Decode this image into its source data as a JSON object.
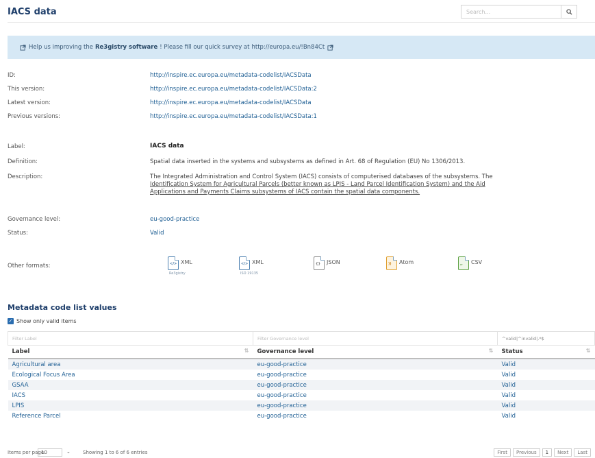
{
  "header": {
    "title": "IACS data",
    "search_placeholder": "Search...",
    "search_icon": "magnifier-icon"
  },
  "banner": {
    "text_before": "Help us improving the",
    "software": "Re3gistry software",
    "text_after": "! Please fill our quick survey at",
    "link": "http://europa.eu/!Bn84Ct"
  },
  "versions": {
    "id_label": "ID:",
    "id_value": "http://inspire.ec.europa.eu/metadata-codelist/IACSData",
    "this_label": "This version:",
    "this_value": "http://inspire.ec.europa.eu/metadata-codelist/IACSData:2",
    "latest_label": "Latest version:",
    "latest_value": "http://inspire.ec.europa.eu/metadata-codelist/IACSData",
    "previous_label": "Previous versions:",
    "previous_value": "http://inspire.ec.europa.eu/metadata-codelist/IACSData:1"
  },
  "details": {
    "label_label": "Label:",
    "label_value": "IACS data",
    "definition_label": "Definition:",
    "definition_value": "Spatial data inserted in the systems and subsystems as defined in Art. 68 of Regulation (EU) No 1306/2013.",
    "description_label": "Description:",
    "description_line1": "The Integrated Administration and Control System (IACS) consists of computerised databases of the subsystems. The",
    "description_line2": "Identification System for Agricultural Parcels (better known as LPIS - Land Parcel Identification System) and the Aid",
    "description_line3": "Applications and Payments Claims subsystems of IACS contain the spatial data components.",
    "governance_label": "Governance level:",
    "governance_value": "eu-good-practice",
    "status_label": "Status:",
    "status_value": "Valid",
    "formats_label": "Other formats:"
  },
  "formats": [
    {
      "label": "XML",
      "sub": "Re3gistry",
      "color": "#4a7fb0"
    },
    {
      "label": "XML",
      "sub": "ISO 19135",
      "color": "#4a7fb0"
    },
    {
      "label": "JSON",
      "sub": "",
      "color": "#888888"
    },
    {
      "label": "Atom",
      "sub": "",
      "color": "#e0a030"
    },
    {
      "label": "CSV",
      "sub": "",
      "color": "#5aa040"
    }
  ],
  "codelist": {
    "title": "Metadata code list values",
    "show_valid_label": "Show only valid items",
    "filter_label": "Filter Label",
    "filter_governance": "Filter Governance level",
    "filter_status": "^valid|^invalid|.*$",
    "columns": [
      "Label",
      "Governance level",
      "Status"
    ],
    "rows": [
      {
        "label": "Agricultural area",
        "governance": "eu-good-practice",
        "status": "Valid"
      },
      {
        "label": "Ecological Focus Area",
        "governance": "eu-good-practice",
        "status": "Valid"
      },
      {
        "label": "GSAA",
        "governance": "eu-good-practice",
        "status": "Valid"
      },
      {
        "label": "IACS",
        "governance": "eu-good-practice",
        "status": "Valid"
      },
      {
        "label": "LPIS",
        "governance": "eu-good-practice",
        "status": "Valid"
      },
      {
        "label": "Reference Parcel",
        "governance": "eu-good-practice",
        "status": "Valid"
      }
    ]
  },
  "footer": {
    "per_page_label": "Items per page:",
    "per_page_value": "10",
    "showing": "Showing 1 to 6 of 6 entries",
    "first": "First",
    "previous": "Previous",
    "page": "1",
    "next": "Next",
    "last": "Last"
  }
}
